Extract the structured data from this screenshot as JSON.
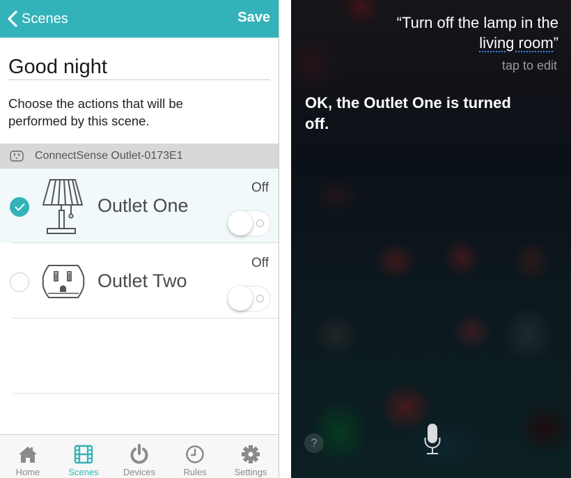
{
  "app": {
    "navbar": {
      "back_label": "Scenes",
      "save_label": "Save",
      "bg_color": "#33b3b9"
    },
    "scene_name_value": "Good night",
    "instructions": "Choose the actions that will be performed by this scene.",
    "device_group": {
      "icon": "outlet-icon",
      "label": "ConnectSense Outlet-0173E1"
    },
    "outlets": [
      {
        "name": "Outlet One",
        "icon": "lamp-icon",
        "selected": true,
        "state_label": "Off",
        "toggle_on": false
      },
      {
        "name": "Outlet Two",
        "icon": "wall-outlet-icon",
        "selected": false,
        "state_label": "Off",
        "toggle_on": false
      }
    ],
    "tabbar": {
      "active": "Scenes",
      "items": [
        {
          "label": "Home",
          "icon": "home-icon"
        },
        {
          "label": "Scenes",
          "icon": "film-icon"
        },
        {
          "label": "Devices",
          "icon": "power-icon"
        },
        {
          "label": "Rules",
          "icon": "clock-icon"
        },
        {
          "label": "Settings",
          "icon": "gear-icon"
        }
      ]
    }
  },
  "siri": {
    "query_line1": "“Turn off the lamp in the",
    "query_line2_underlined": "living room",
    "query_close_quote": "”",
    "tap_to_edit": "tap to edit",
    "response": "OK, the Outlet One is turned off.",
    "help_label": "?",
    "underline_color": "#3d8bff"
  }
}
